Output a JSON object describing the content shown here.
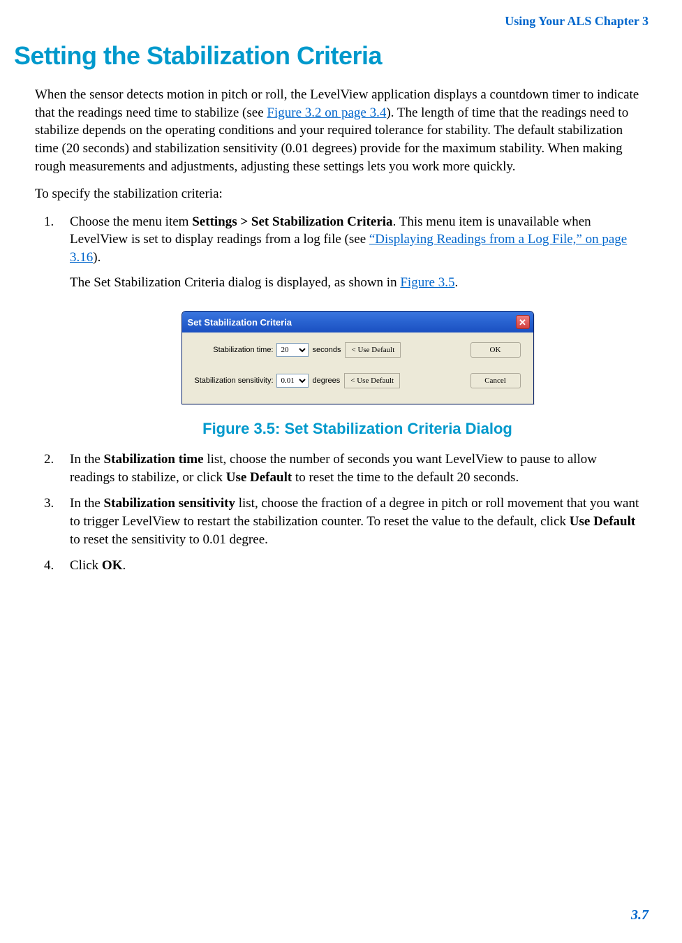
{
  "header": {
    "title": "Using Your ALS  Chapter 3"
  },
  "section": {
    "title": "Setting the Stabilization Criteria"
  },
  "intro": {
    "part1": "When the sensor detects motion in pitch or roll, the LevelView application displays a countdown timer to indicate that the readings need time to stabilize (see ",
    "link1": "Figure 3.2 on page 3.4",
    "part2": "). The length of time that the readings need to stabilize depends on the operating conditions and your required tolerance for stability. The default stabilization time (20 seconds) and stabilization sensitivity (0.01 degrees) provide for the maximum stability. When making rough measurements and adjustments, adjusting these settings lets you work more quickly."
  },
  "lead_in": "To specify the stabilization criteria:",
  "steps": {
    "s1": {
      "part1": "Choose the menu item ",
      "bold1": "Settings > Set Stabilization Criteria",
      "part2": ". This menu item is unavailable when LevelView is set to display readings from a log file (see ",
      "link1": "“Displaying Readings from a Log File,” on page 3.16",
      "part3": ").",
      "sub_part1": "The Set Stabilization Criteria dialog is displayed, as shown in ",
      "sub_link": "Figure 3.5",
      "sub_part2": "."
    },
    "s2": {
      "part1": "In the ",
      "bold1": "Stabilization time",
      "part2": " list, choose the number of seconds you want LevelView to pause to allow readings to stabilize, or click ",
      "bold2": "Use Default",
      "part3": " to reset the time to the default 20 seconds."
    },
    "s3": {
      "part1": "In the ",
      "bold1": "Stabilization sensitivity",
      "part2": " list, choose the fraction of a degree in pitch or roll movement that you want to trigger LevelView to restart the stabilization counter. To reset the value to the default, click ",
      "bold2": "Use Default",
      "part3": " to reset the sensitivity to 0.01 degree."
    },
    "s4": {
      "part1": "Click ",
      "bold1": "OK",
      "part2": "."
    }
  },
  "dialog": {
    "title": "Set Stabilization Criteria",
    "row1": {
      "label": "Stabilization time:",
      "value": "20",
      "unit": "seconds",
      "default_btn": "< Use Default"
    },
    "row2": {
      "label": "Stabilization sensitivity:",
      "value": "0.01",
      "unit": "degrees",
      "default_btn": "< Use Default"
    },
    "ok_btn": "OK",
    "cancel_btn": "Cancel"
  },
  "figure_caption": "Figure 3.5: Set Stabilization Criteria Dialog",
  "footer": {
    "page_number": "3.7"
  }
}
